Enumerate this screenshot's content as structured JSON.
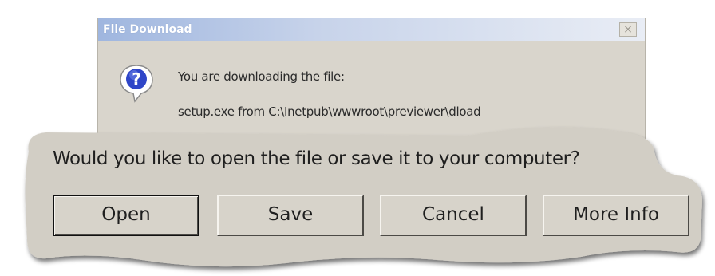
{
  "dialog": {
    "title": "File Download",
    "close_glyph": "×",
    "message_line1": "You are downloading the file:",
    "message_line2": "setup.exe from C:\\Inetpub\\wwwroot\\previewer\\dload",
    "icon": "question-icon"
  },
  "callout": {
    "question": "Would you like to open the file or save it to your computer?",
    "buttons": {
      "open": "Open",
      "save": "Save",
      "cancel": "Cancel",
      "more_info": "More Info"
    }
  },
  "colors": {
    "dialog_bg": "#d9d5cc",
    "callout_bg": "#d2cec5",
    "titlebar_start": "#9fb6df"
  }
}
